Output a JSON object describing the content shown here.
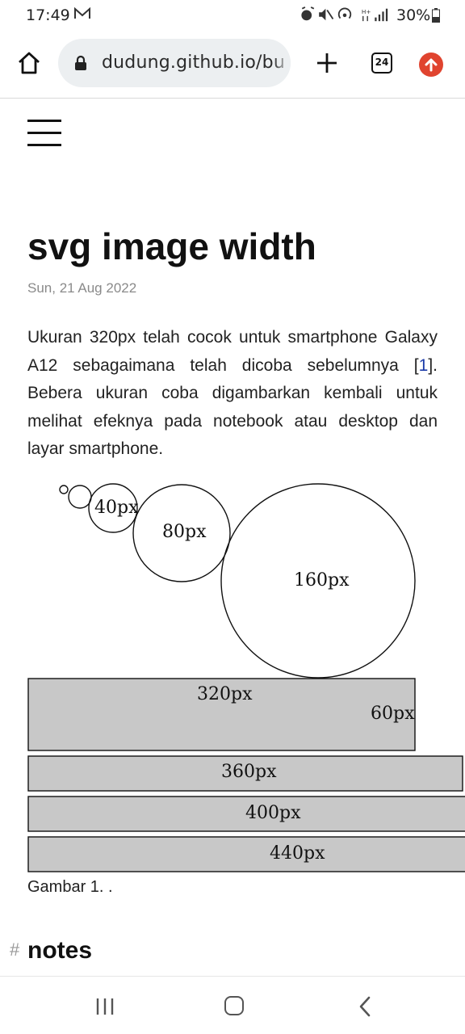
{
  "status": {
    "time": "17:49",
    "battery_pct": "30%",
    "icons": [
      "mail-icon",
      "alarm-icon",
      "mute-icon",
      "hotspot-icon",
      "data-icon",
      "signal-icon",
      "battery-icon"
    ]
  },
  "browser": {
    "url": "dudung.github.io/bu",
    "tab_count": "24"
  },
  "post": {
    "title": "svg image width",
    "date": "Sun, 21 Aug 2022",
    "paragraph_before": "Ukuran 320px telah cocok untuk smartphone Galaxy A12 sebagaimana telah dicoba sebelumnya [",
    "ref": "1",
    "paragraph_after": "]. Bebera ukuran coba digambarkan kembali untuk melihat efeknya pada notebook atau desktop dan layar smartphone."
  },
  "figure": {
    "circle_labels": [
      "40px",
      "80px",
      "160px"
    ],
    "rect_labels": [
      "320px",
      "60px",
      "360px",
      "400px",
      "440px"
    ],
    "fill_color": "#c8c8c8",
    "caption": "Gambar 1. ."
  },
  "notes": {
    "hash": "#",
    "heading": "notes"
  }
}
